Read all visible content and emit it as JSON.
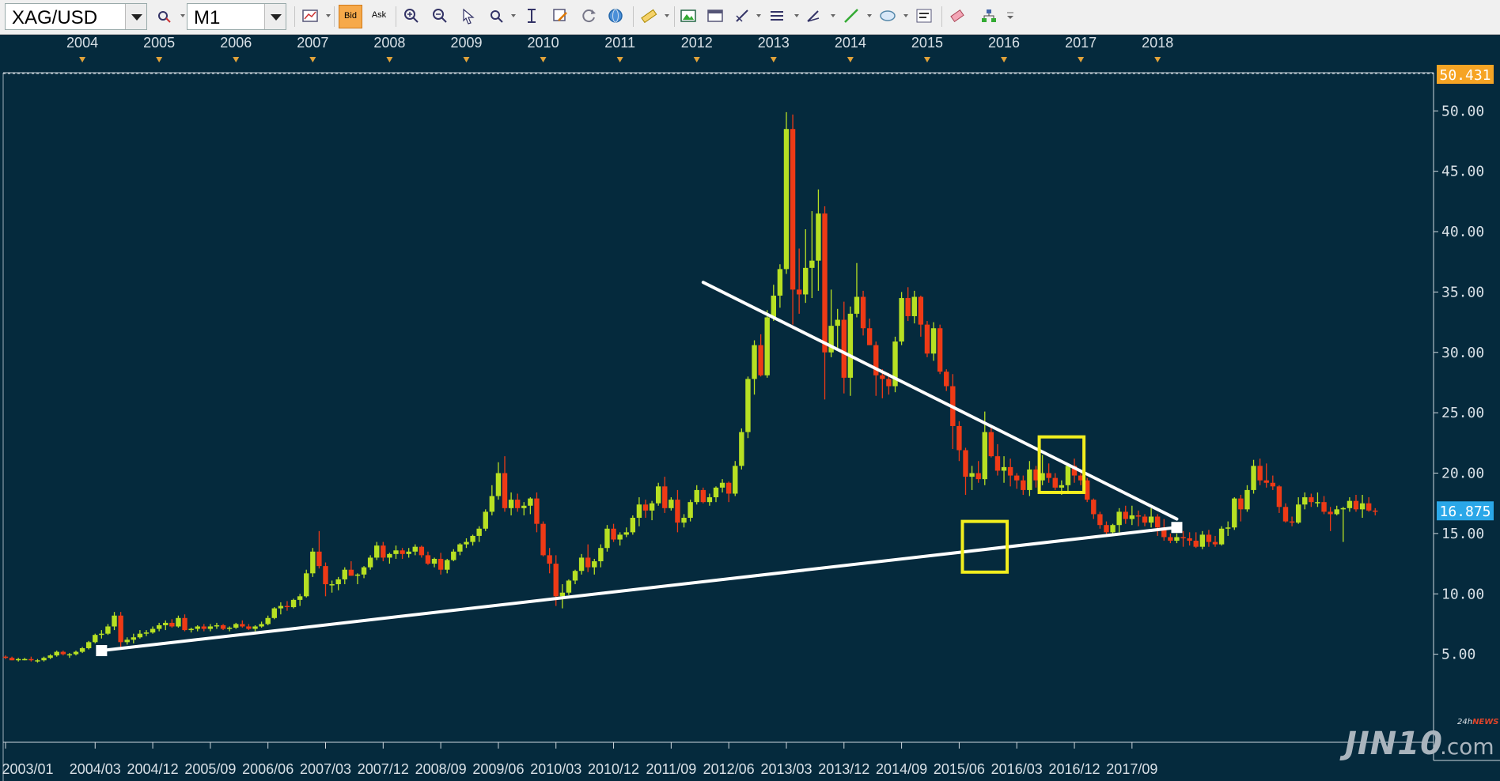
{
  "toolbar": {
    "symbol": "XAG/USD",
    "timeframe": "M1",
    "bid_label": "Bid",
    "ask_label": "Ask",
    "icons": [
      "chart-type-icon",
      "bid-icon",
      "ask-icon",
      "zoom-in-icon",
      "zoom-out-icon",
      "cursor-icon",
      "magnifier-icon",
      "crosshair-icon",
      "edit-icon",
      "refresh-icon",
      "globe-icon",
      "ruler-icon",
      "image-icon",
      "window-icon",
      "draw-tools-icon",
      "lines-icon",
      "pen-icon",
      "line-icon",
      "ellipse-icon",
      "text-icon",
      "eraser-icon",
      "tree-icon",
      "more-icon"
    ]
  },
  "logo": {
    "main": "JIN10",
    "suffix": ".com",
    "tag_prefix": "24h",
    "tag_news": "NEWS"
  },
  "chart_data": {
    "type": "candlestick",
    "symbol": "XAG/USD",
    "timeframe": "M1",
    "top_axis_years": [
      "2004",
      "2005",
      "2006",
      "2007",
      "2008",
      "2009",
      "2010",
      "2011",
      "2012",
      "2013",
      "2014",
      "2015",
      "2016",
      "2017",
      "2018"
    ],
    "bottom_axis_labels": [
      "2003/01",
      "2004/03",
      "2004/12",
      "2005/09",
      "2006/06",
      "2007/03",
      "2007/12",
      "2008/09",
      "2009/06",
      "2010/03",
      "2010/12",
      "2011/09",
      "2012/06",
      "2013/03",
      "2013/12",
      "2014/09",
      "2015/06",
      "2016/03",
      "2016/12",
      "2017/09"
    ],
    "y_ticks": [
      "5.00",
      "10.00",
      "15.00",
      "20.00",
      "25.00",
      "30.00",
      "35.00",
      "40.00",
      "45.00",
      "50.00"
    ],
    "ylim": [
      0,
      52.9
    ],
    "high_label": "50.431",
    "last_price_label": "16.875",
    "bull_color": "#b7e023",
    "bear_color": "#ee3a16",
    "candles": [
      [
        4.8,
        4.9,
        4.6,
        4.7
      ],
      [
        4.7,
        4.8,
        4.5,
        4.5
      ],
      [
        4.5,
        4.7,
        4.4,
        4.6
      ],
      [
        4.6,
        4.7,
        4.5,
        4.6
      ],
      [
        4.6,
        4.8,
        4.4,
        4.5
      ],
      [
        4.5,
        4.6,
        4.3,
        4.5
      ],
      [
        4.5,
        4.8,
        4.4,
        4.7
      ],
      [
        4.7,
        5.0,
        4.6,
        4.9
      ],
      [
        4.9,
        5.3,
        4.8,
        5.2
      ],
      [
        5.2,
        5.3,
        4.9,
        5.0
      ],
      [
        5.0,
        5.1,
        4.7,
        5.0
      ],
      [
        5.0,
        5.3,
        4.9,
        5.2
      ],
      [
        5.2,
        5.6,
        5.1,
        5.5
      ],
      [
        5.5,
        6.1,
        5.4,
        6.0
      ],
      [
        6.0,
        6.7,
        5.9,
        6.6
      ],
      [
        6.6,
        7.0,
        6.3,
        6.7
      ],
      [
        6.7,
        7.5,
        6.6,
        7.3
      ],
      [
        7.3,
        8.5,
        7.0,
        8.2
      ],
      [
        8.2,
        8.5,
        5.6,
        6.0
      ],
      [
        6.0,
        6.4,
        5.8,
        6.2
      ],
      [
        6.2,
        6.7,
        5.9,
        6.4
      ],
      [
        6.4,
        7.0,
        6.3,
        6.7
      ],
      [
        6.7,
        7.0,
        6.5,
        6.8
      ],
      [
        6.8,
        7.3,
        6.7,
        7.1
      ],
      [
        7.1,
        7.6,
        6.9,
        7.4
      ],
      [
        7.4,
        7.8,
        7.0,
        7.6
      ],
      [
        7.6,
        7.9,
        7.2,
        7.3
      ],
      [
        7.3,
        8.2,
        7.2,
        8.0
      ],
      [
        8.0,
        8.3,
        6.9,
        7.0
      ],
      [
        7.0,
        7.2,
        6.8,
        7.1
      ],
      [
        7.1,
        7.4,
        6.9,
        7.3
      ],
      [
        7.3,
        7.5,
        6.9,
        7.1
      ],
      [
        7.1,
        7.5,
        6.9,
        7.3
      ],
      [
        7.3,
        7.6,
        7.1,
        7.4
      ],
      [
        7.4,
        7.5,
        7.0,
        7.1
      ],
      [
        7.1,
        7.3,
        6.9,
        7.2
      ],
      [
        7.2,
        7.6,
        7.1,
        7.5
      ],
      [
        7.5,
        7.8,
        7.2,
        7.3
      ],
      [
        7.3,
        7.5,
        7.0,
        7.1
      ],
      [
        7.1,
        7.4,
        6.9,
        7.3
      ],
      [
        7.3,
        7.7,
        7.2,
        7.5
      ],
      [
        7.5,
        8.2,
        7.4,
        8.0
      ],
      [
        8.0,
        8.9,
        7.9,
        8.8
      ],
      [
        8.8,
        9.3,
        8.3,
        9.0
      ],
      [
        9.0,
        9.4,
        8.6,
        8.9
      ],
      [
        8.9,
        9.6,
        8.8,
        9.5
      ],
      [
        9.5,
        10.0,
        9.0,
        9.8
      ],
      [
        9.8,
        12.0,
        9.7,
        11.7
      ],
      [
        11.7,
        13.8,
        11.4,
        13.5
      ],
      [
        13.5,
        15.2,
        12.1,
        12.3
      ],
      [
        12.3,
        12.6,
        9.8,
        10.8
      ],
      [
        10.8,
        11.1,
        10.1,
        10.8
      ],
      [
        10.8,
        11.4,
        10.3,
        11.2
      ],
      [
        11.2,
        12.2,
        10.8,
        12.0
      ],
      [
        12.0,
        12.7,
        11.5,
        11.5
      ],
      [
        11.5,
        11.7,
        10.8,
        11.6
      ],
      [
        11.6,
        12.3,
        11.3,
        12.2
      ],
      [
        12.2,
        13.2,
        12.0,
        13.0
      ],
      [
        13.0,
        14.3,
        12.8,
        14.0
      ],
      [
        14.0,
        14.3,
        12.7,
        13.0
      ],
      [
        13.0,
        13.4,
        12.5,
        13.3
      ],
      [
        13.3,
        14.0,
        12.9,
        13.6
      ],
      [
        13.6,
        13.8,
        12.9,
        13.3
      ],
      [
        13.3,
        13.8,
        13.0,
        13.5
      ],
      [
        13.5,
        14.1,
        13.2,
        13.9
      ],
      [
        13.9,
        14.0,
        13.0,
        13.2
      ],
      [
        13.2,
        13.5,
        12.4,
        12.5
      ],
      [
        12.5,
        13.0,
        12.2,
        12.9
      ],
      [
        12.9,
        13.4,
        11.6,
        12.0
      ],
      [
        12.0,
        12.9,
        11.7,
        12.8
      ],
      [
        12.8,
        13.7,
        12.7,
        13.5
      ],
      [
        13.5,
        14.2,
        13.2,
        14.1
      ],
      [
        14.1,
        14.6,
        13.8,
        14.3
      ],
      [
        14.3,
        14.9,
        14.0,
        14.8
      ],
      [
        14.8,
        15.6,
        14.3,
        15.4
      ],
      [
        15.4,
        17.0,
        15.2,
        16.8
      ],
      [
        16.8,
        19.0,
        16.5,
        18.1
      ],
      [
        18.1,
        20.9,
        17.8,
        20.0
      ],
      [
        20.0,
        21.4,
        16.8,
        17.1
      ],
      [
        17.1,
        18.4,
        16.5,
        17.8
      ],
      [
        17.8,
        18.3,
        16.8,
        17.1
      ],
      [
        17.1,
        17.6,
        16.5,
        17.3
      ],
      [
        17.3,
        18.0,
        16.6,
        17.9
      ],
      [
        17.9,
        18.4,
        15.1,
        15.8
      ],
      [
        15.8,
        16.0,
        13.1,
        13.2
      ],
      [
        13.2,
        13.8,
        11.7,
        12.5
      ],
      [
        12.5,
        13.2,
        9.0,
        9.8
      ],
      [
        9.8,
        10.8,
        8.8,
        10.1
      ],
      [
        10.1,
        11.2,
        9.9,
        11.1
      ],
      [
        11.1,
        12.0,
        10.8,
        11.9
      ],
      [
        11.9,
        13.3,
        11.6,
        13.0
      ],
      [
        13.0,
        14.1,
        11.8,
        12.2
      ],
      [
        12.2,
        12.9,
        11.6,
        12.7
      ],
      [
        12.7,
        14.1,
        12.2,
        13.8
      ],
      [
        13.8,
        15.7,
        13.5,
        15.4
      ],
      [
        15.4,
        15.8,
        14.3,
        14.5
      ],
      [
        14.5,
        15.1,
        14.0,
        14.9
      ],
      [
        14.9,
        15.5,
        14.7,
        15.1
      ],
      [
        15.1,
        16.5,
        14.9,
        16.3
      ],
      [
        16.3,
        18.0,
        15.6,
        17.4
      ],
      [
        17.4,
        17.8,
        16.3,
        16.9
      ],
      [
        16.9,
        17.7,
        16.1,
        17.5
      ],
      [
        17.5,
        19.2,
        17.3,
        18.9
      ],
      [
        18.9,
        19.7,
        16.7,
        17.1
      ],
      [
        17.1,
        18.0,
        16.9,
        17.8
      ],
      [
        17.8,
        18.6,
        15.1,
        15.9
      ],
      [
        15.9,
        16.6,
        15.5,
        16.3
      ],
      [
        16.3,
        17.8,
        16.0,
        17.6
      ],
      [
        17.6,
        19.0,
        17.4,
        18.6
      ],
      [
        18.6,
        18.8,
        17.5,
        17.6
      ],
      [
        17.6,
        18.3,
        17.3,
        18.0
      ],
      [
        18.0,
        18.9,
        17.6,
        18.8
      ],
      [
        18.8,
        19.5,
        18.4,
        19.2
      ],
      [
        19.2,
        19.3,
        17.6,
        18.3
      ],
      [
        18.3,
        21.0,
        18.1,
        20.6
      ],
      [
        20.6,
        23.7,
        20.3,
        23.4
      ],
      [
        23.4,
        28.0,
        22.9,
        27.8
      ],
      [
        27.8,
        31.0,
        26.5,
        30.6
      ],
      [
        30.6,
        31.5,
        28.0,
        28.1
      ],
      [
        28.1,
        33.5,
        27.9,
        32.9
      ],
      [
        32.9,
        35.6,
        32.6,
        34.7
      ],
      [
        34.7,
        37.3,
        33.7,
        36.9
      ],
      [
        36.9,
        49.9,
        36.5,
        48.5
      ],
      [
        48.5,
        49.7,
        32.3,
        35.2
      ],
      [
        35.2,
        38.6,
        33.2,
        34.8
      ],
      [
        34.8,
        40.2,
        34.1,
        37.0
      ],
      [
        37.0,
        41.7,
        34.5,
        37.6
      ],
      [
        37.6,
        43.5,
        35.1,
        41.5
      ],
      [
        41.5,
        42.1,
        26.1,
        30.0
      ],
      [
        30.0,
        35.2,
        29.6,
        32.2
      ],
      [
        32.2,
        33.6,
        30.3,
        32.7
      ],
      [
        32.7,
        34.2,
        26.6,
        27.9
      ],
      [
        27.9,
        33.8,
        26.4,
        33.2
      ],
      [
        33.2,
        37.4,
        32.9,
        34.6
      ],
      [
        34.6,
        35.1,
        31.4,
        32.0
      ],
      [
        32.0,
        32.8,
        30.6,
        30.6
      ],
      [
        30.6,
        30.9,
        26.4,
        28.1
      ],
      [
        28.1,
        28.6,
        26.2,
        27.8
      ],
      [
        27.8,
        28.3,
        26.5,
        27.2
      ],
      [
        27.2,
        31.3,
        26.7,
        30.9
      ],
      [
        30.9,
        35.0,
        30.6,
        34.5
      ],
      [
        34.5,
        35.4,
        32.6,
        33.0
      ],
      [
        33.0,
        35.1,
        32.4,
        34.6
      ],
      [
        34.6,
        34.7,
        31.3,
        32.3
      ],
      [
        32.3,
        32.6,
        29.6,
        29.9
      ],
      [
        29.9,
        32.5,
        29.3,
        32.0
      ],
      [
        32.0,
        32.3,
        28.2,
        28.4
      ],
      [
        28.4,
        28.6,
        26.8,
        27.2
      ],
      [
        27.2,
        28.2,
        22.0,
        23.9
      ],
      [
        23.9,
        24.3,
        21.0,
        21.9
      ],
      [
        21.9,
        22.1,
        18.2,
        19.7
      ],
      [
        19.7,
        20.6,
        18.6,
        20.0
      ],
      [
        20.0,
        21.0,
        19.2,
        19.5
      ],
      [
        19.5,
        25.1,
        19.0,
        23.4
      ],
      [
        23.4,
        23.9,
        21.3,
        21.4
      ],
      [
        21.4,
        22.4,
        19.8,
        20.2
      ],
      [
        20.2,
        21.4,
        19.2,
        20.5
      ],
      [
        20.5,
        21.2,
        18.9,
        19.8
      ],
      [
        19.8,
        20.0,
        18.7,
        19.4
      ],
      [
        19.4,
        19.8,
        18.2,
        18.6
      ],
      [
        18.6,
        21.0,
        18.1,
        20.3
      ],
      [
        20.3,
        20.6,
        18.8,
        19.4
      ],
      [
        19.4,
        21.5,
        19.0,
        20.0
      ],
      [
        20.0,
        20.8,
        19.2,
        19.6
      ],
      [
        19.6,
        20.0,
        18.6,
        18.8
      ],
      [
        18.8,
        19.4,
        18.2,
        19.0
      ],
      [
        19.0,
        20.8,
        18.4,
        20.6
      ],
      [
        20.6,
        21.2,
        19.2,
        19.8
      ],
      [
        19.8,
        20.0,
        19.0,
        19.4
      ],
      [
        19.4,
        19.6,
        17.6,
        17.8
      ],
      [
        17.8,
        17.9,
        16.2,
        16.6
      ],
      [
        16.6,
        16.8,
        15.4,
        15.7
      ],
      [
        15.7,
        16.0,
        14.8,
        15.1
      ],
      [
        15.1,
        15.8,
        14.9,
        15.7
      ],
      [
        15.7,
        17.1,
        15.1,
        16.8
      ],
      [
        16.8,
        17.3,
        15.8,
        16.2
      ],
      [
        16.2,
        17.3,
        15.7,
        16.5
      ],
      [
        16.5,
        16.9,
        15.6,
        16.4
      ],
      [
        16.4,
        16.6,
        15.6,
        15.9
      ],
      [
        15.9,
        17.1,
        15.5,
        16.4
      ],
      [
        16.4,
        16.6,
        14.8,
        15.5
      ],
      [
        15.5,
        16.2,
        14.4,
        14.7
      ],
      [
        14.7,
        15.0,
        14.2,
        14.4
      ],
      [
        14.4,
        15.0,
        14.2,
        14.7
      ],
      [
        14.7,
        15.2,
        13.9,
        14.6
      ],
      [
        14.6,
        15.1,
        14.0,
        14.4
      ],
      [
        14.4,
        15.1,
        13.8,
        13.9
      ],
      [
        13.9,
        15.2,
        13.7,
        14.9
      ],
      [
        14.9,
        15.3,
        13.9,
        14.3
      ],
      [
        14.3,
        14.8,
        13.9,
        14.1
      ],
      [
        14.1,
        15.6,
        14.0,
        15.4
      ],
      [
        15.4,
        16.0,
        14.8,
        15.5
      ],
      [
        15.5,
        18.0,
        15.3,
        17.9
      ],
      [
        17.9,
        18.2,
        16.0,
        17.0
      ],
      [
        17.0,
        19.0,
        16.8,
        18.6
      ],
      [
        18.6,
        21.1,
        18.3,
        20.6
      ],
      [
        20.6,
        21.2,
        19.0,
        19.4
      ],
      [
        19.4,
        20.8,
        18.8,
        19.2
      ],
      [
        19.2,
        19.8,
        18.6,
        18.9
      ],
      [
        18.9,
        19.0,
        16.7,
        17.2
      ],
      [
        17.2,
        17.5,
        15.9,
        16.0
      ],
      [
        16.0,
        16.4,
        15.6,
        15.9
      ],
      [
        15.9,
        18.0,
        15.8,
        17.4
      ],
      [
        17.4,
        18.4,
        17.0,
        18.0
      ],
      [
        18.0,
        18.3,
        17.2,
        17.6
      ],
      [
        17.6,
        18.4,
        17.2,
        17.6
      ],
      [
        17.6,
        18.1,
        16.6,
        16.8
      ],
      [
        16.8,
        17.2,
        15.2,
        16.6
      ],
      [
        16.6,
        17.3,
        16.5,
        17.0
      ],
      [
        17.0,
        17.2,
        14.3,
        17.1
      ],
      [
        17.1,
        18.0,
        16.8,
        17.7
      ],
      [
        17.7,
        18.2,
        16.8,
        17.0
      ],
      [
        17.0,
        18.2,
        16.3,
        17.5
      ],
      [
        17.5,
        18.0,
        16.8,
        16.9
      ],
      [
        16.9,
        17.1,
        16.5,
        16.8
      ]
    ],
    "trendlines": [
      {
        "name": "support",
        "points": [
          [
            "2004/04",
            5.3
          ],
          [
            "2018/04",
            15.5
          ]
        ]
      },
      {
        "name": "resistance",
        "points": [
          [
            "2012/02",
            35.8
          ],
          [
            "2018/04",
            16.2
          ]
        ]
      }
    ],
    "highlight_boxes": [
      {
        "name": "consolidation-2015",
        "from": "2015/07",
        "to": "2016/01",
        "low": 11.8,
        "high": 16.0
      },
      {
        "name": "peak-2016",
        "from": "2016/07",
        "to": "2017/01",
        "low": 18.4,
        "high": 23.0
      }
    ],
    "grid": false
  }
}
